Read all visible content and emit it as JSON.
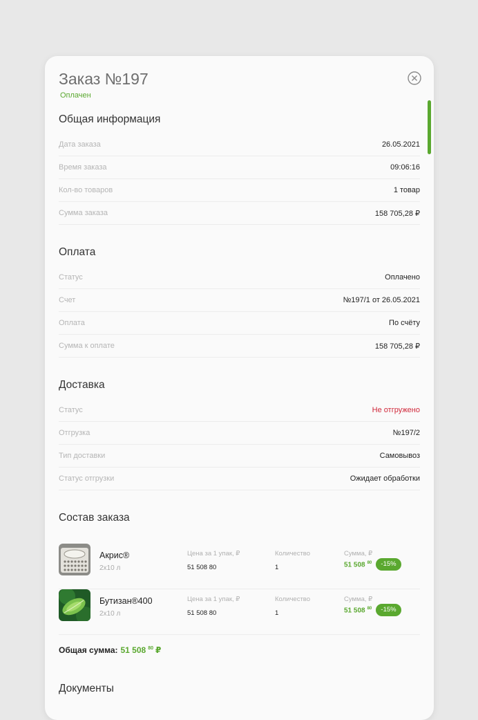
{
  "order": {
    "title": "Заказ №197",
    "status": "Оплачен"
  },
  "general": {
    "title": "Общая информация",
    "rows": [
      {
        "label": "Дата заказа",
        "value": "26.05.2021"
      },
      {
        "label": "Время заказа",
        "value": "09:06:16"
      },
      {
        "label": "Кол-во товаров",
        "value": "1 товар"
      },
      {
        "label": "Сумма заказа",
        "value": "158 705,28 ₽"
      }
    ]
  },
  "payment": {
    "title": "Оплата",
    "rows": [
      {
        "label": "Статус",
        "value": "Оплачено"
      },
      {
        "label": "Счет",
        "value": "№197/1 от 26.05.2021"
      },
      {
        "label": "Оплата",
        "value": "По счёту"
      },
      {
        "label": "Сумма к оплате",
        "value": "158 705,28 ₽"
      }
    ]
  },
  "delivery": {
    "title": "Доставка",
    "rows": [
      {
        "label": "Статус",
        "value": "Не отгружено"
      },
      {
        "label": "Отгрузка",
        "value": "№197/2"
      },
      {
        "label": "Тип доставки",
        "value": "Самовывоз"
      },
      {
        "label": "Статус отгрузки",
        "value": "Ожидает обработки"
      }
    ]
  },
  "composition": {
    "title": "Состав заказа",
    "headers": {
      "price": "Цена за 1 упак, ₽",
      "qty": "Количество",
      "sum": "Сумма, ₽"
    },
    "items": [
      {
        "name": "Акрис®",
        "pack": "2x10 л",
        "price": "51 508 80",
        "qty": "1",
        "sum_main": "51 508",
        "sum_cents": "80",
        "discount": "-15%"
      },
      {
        "name": "Бутизан®400",
        "pack": "2x10 л",
        "price": "51 508 80",
        "qty": "1",
        "sum_main": "51 508",
        "sum_cents": "80",
        "discount": "-15%"
      }
    ],
    "total_label": "Общая сумма:",
    "total_main": "51 508",
    "total_cents": "80",
    "total_currency": "₽"
  },
  "documents": {
    "title": "Документы"
  },
  "colors": {
    "accent": "#5aa82f",
    "danger": "#d0283a"
  }
}
